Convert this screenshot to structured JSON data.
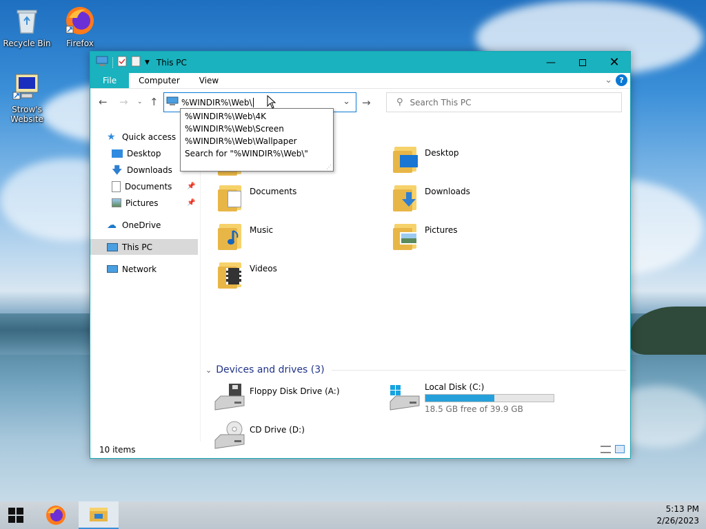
{
  "desktop": {
    "icons": [
      {
        "label": "Recycle Bin"
      },
      {
        "label": "Firefox"
      },
      {
        "label": "Strow's Website"
      }
    ]
  },
  "window": {
    "title": "This PC",
    "ribbon_tabs": [
      "File",
      "Computer",
      "View"
    ],
    "address": {
      "value": "%WINDIR%\\Web\\"
    },
    "search": {
      "placeholder": "Search This PC"
    },
    "autocomplete": [
      "%WINDIR%\\Web\\4K",
      "%WINDIR%\\Web\\Screen",
      "%WINDIR%\\Web\\Wallpaper",
      "Search for \"%WINDIR%\\Web\\\""
    ],
    "sidebar": {
      "quick_access": "Quick access",
      "items": [
        "Desktop",
        "Downloads",
        "Documents",
        "Pictures"
      ],
      "onedrive": "OneDrive",
      "this_pc": "This PC",
      "network": "Network"
    },
    "folders": [
      "Desktop",
      "Documents",
      "Downloads",
      "Music",
      "Pictures",
      "Videos"
    ],
    "devices_header": "Devices and drives (3)",
    "drives": [
      {
        "name": "Floppy Disk Drive (A:)"
      },
      {
        "name": "Local Disk (C:)",
        "free_text": "18.5 GB free of 39.9 GB",
        "used_fraction": 0.536
      },
      {
        "name": "CD Drive (D:)"
      }
    ],
    "status": {
      "items": "10 items"
    }
  },
  "taskbar": {
    "time": "5:13 PM",
    "date": "2/26/2023"
  },
  "colors": {
    "titlebar": "#19b2be",
    "accent": "#0a78d4",
    "drive_bar": "#26a0da"
  }
}
